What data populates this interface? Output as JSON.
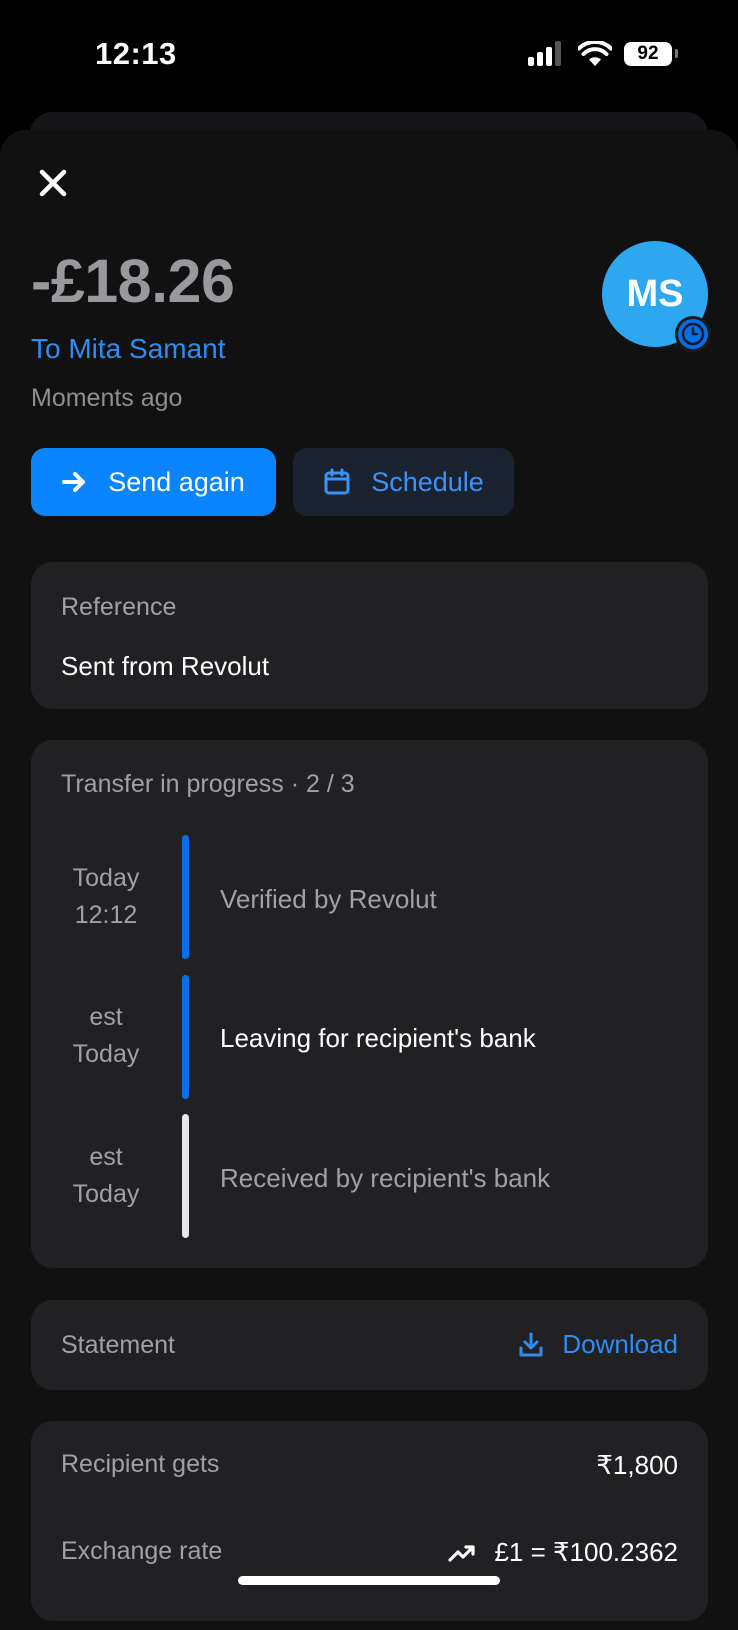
{
  "status_bar": {
    "time": "12:13",
    "battery": "92"
  },
  "header": {
    "amount": "-£18.26",
    "recipient_link": "To Mita Samant",
    "time_ago": "Moments ago",
    "avatar_initials": "MS"
  },
  "actions": {
    "send_again": "Send again",
    "schedule": "Schedule"
  },
  "reference": {
    "label": "Reference",
    "value": "Sent from Revolut"
  },
  "transfer": {
    "title": "Transfer in progress · 2 / 3",
    "steps": [
      {
        "date_line1": "Today",
        "date_line2": "12:12",
        "label": "Verified by Revolut"
      },
      {
        "date_line1": "est",
        "date_line2": "Today",
        "label": "Leaving for recipient's bank"
      },
      {
        "date_line1": "est",
        "date_line2": "Today",
        "label": "Received by recipient's bank"
      }
    ]
  },
  "statement": {
    "label": "Statement",
    "download": "Download"
  },
  "fx": {
    "recipient_label": "Recipient gets",
    "recipient_value": "₹1,800",
    "rate_label": "Exchange rate",
    "rate_value": "£1 = ₹100.2362"
  },
  "colors": {
    "accent": "#0a84ff",
    "link": "#2f8cf3",
    "card": "#212123",
    "timeline_done": "#0a6fe8",
    "timeline_pending": "#e5e5ea"
  }
}
